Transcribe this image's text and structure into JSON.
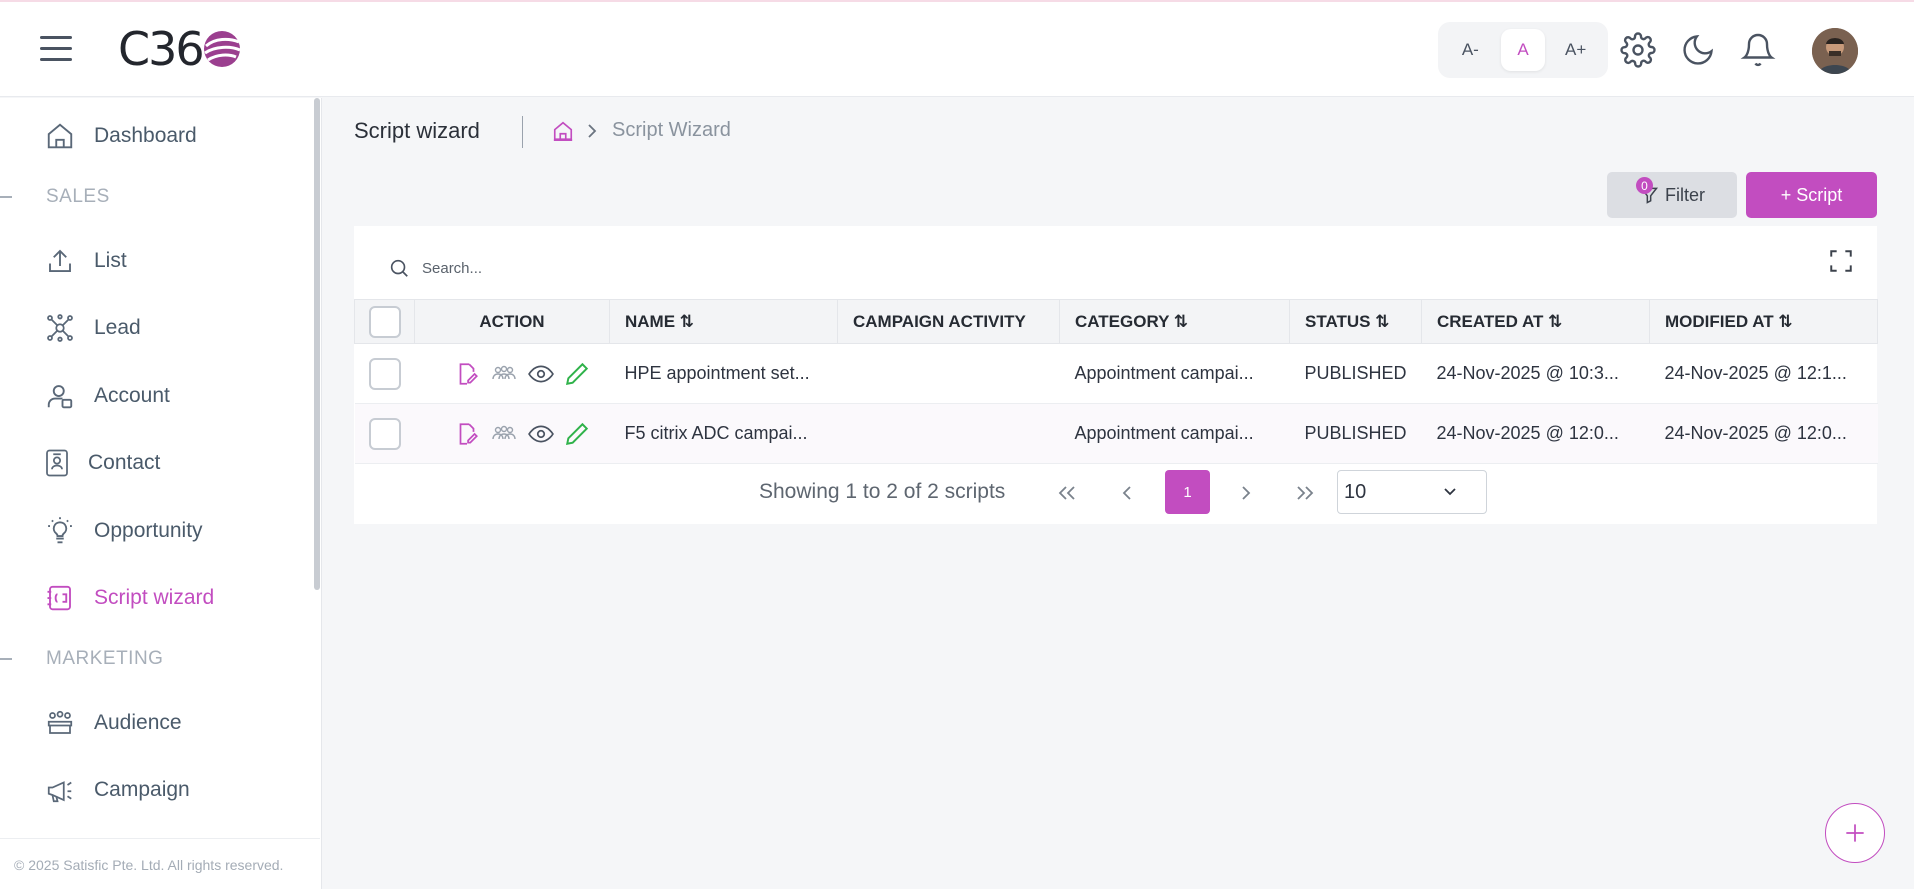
{
  "app": {
    "logo_text": "C36"
  },
  "header": {
    "font_size_buttons": [
      "A-",
      "A",
      "A+"
    ],
    "icons": [
      "settings-icon",
      "moon-icon",
      "bell-icon"
    ]
  },
  "sidebar": {
    "items": [
      {
        "label": "Dashboard",
        "icon": "home-icon"
      },
      {
        "label": "List",
        "icon": "upload-icon"
      },
      {
        "label": "Lead",
        "icon": "network-icon"
      },
      {
        "label": "Account",
        "icon": "user-icon"
      },
      {
        "label": "Contact",
        "icon": "contact-card-icon"
      },
      {
        "label": "Opportunity",
        "icon": "bulb-icon"
      },
      {
        "label": "Script wizard",
        "icon": "script-icon"
      },
      {
        "label": "Audience",
        "icon": "audience-icon"
      },
      {
        "label": "Campaign",
        "icon": "megaphone-icon"
      }
    ],
    "sections": [
      "SALES",
      "MARKETING"
    ],
    "footer": "© 2025 Satisfic Pte. Ltd. All rights reserved."
  },
  "page": {
    "title": "Script wizard",
    "breadcrumb_current": "Script Wizard"
  },
  "toolbar": {
    "filter_label": "Filter",
    "filter_count": "0",
    "add_label": "+ Script"
  },
  "search": {
    "placeholder": "Search..."
  },
  "table": {
    "headers": [
      "ACTION",
      "NAME ⇅",
      "CAMPAIGN ACTIVITY",
      "CATEGORY ⇅",
      "STATUS ⇅",
      "CREATED AT ⇅",
      "MODIFIED AT ⇅"
    ],
    "rows": [
      {
        "name": "HPE appointment set...",
        "campaign_activity": "",
        "category": "Appointment campai...",
        "status": "PUBLISHED",
        "created": "24-Nov-2025 @ 10:3...",
        "modified": "24-Nov-2025 @ 12:1..."
      },
      {
        "name": "F5 citrix ADC campai...",
        "campaign_activity": "",
        "category": "Appointment campai...",
        "status": "PUBLISHED",
        "created": "24-Nov-2025 @ 12:0...",
        "modified": "24-Nov-2025 @ 12:0..."
      }
    ]
  },
  "pagination": {
    "info": "Showing 1 to 2 of 2 scripts",
    "current_page": "1",
    "page_size": "10"
  },
  "colors": {
    "accent": "#c24dc0",
    "edit_green": "#2fb24a"
  }
}
